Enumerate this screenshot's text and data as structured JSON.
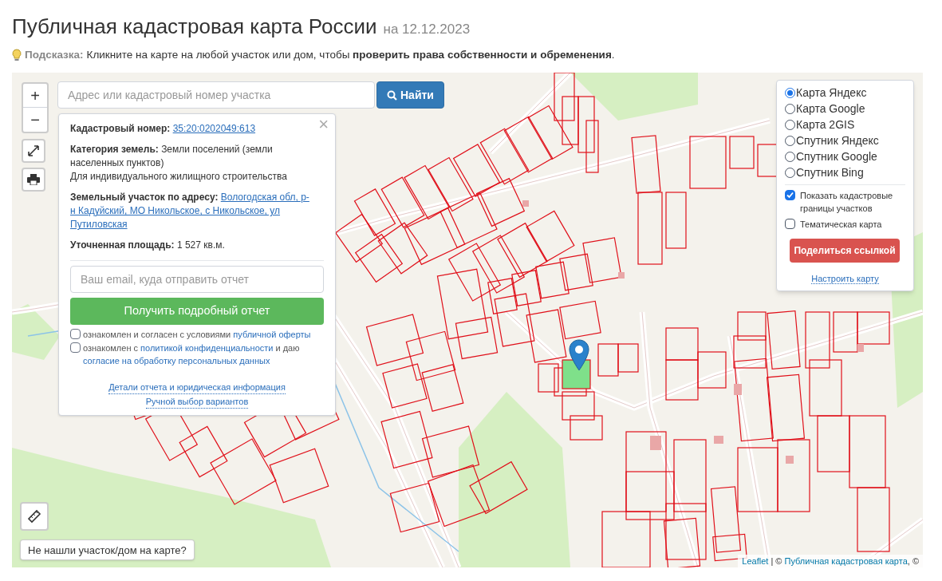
{
  "header": {
    "title": "Публичная кадастровая карта России",
    "date": "на 12.12.2023"
  },
  "hint": {
    "label": "Подсказка:",
    "text": "Кликните на карте на любой участок или дом, чтобы **проверить права собственности и обременения**."
  },
  "search": {
    "placeholder": "Адрес или кадастровый номер участка",
    "button": "Найти"
  },
  "zoom_controls": [
    "+",
    "−"
  ],
  "popup": {
    "close": "×",
    "fields": [
      {
        "label": "Кадастровый номер:",
        "value": "35:20:0202049:613",
        "kind": "link"
      },
      {
        "label": "Категория земель:",
        "value": "Земли поселений (земли населенных пунктов)",
        "note": "Для индивидуального жилищного строительства",
        "kind": "text"
      },
      {
        "label": "Земельный участок по адресу:",
        "value": "Вологодская обл, р-н Кадуйский, МО Никольское, с Никольское, ул Путиловская",
        "kind": "link"
      },
      {
        "label": "Уточненная площадь:",
        "value": "1 527 кв.м.",
        "kind": "text"
      }
    ],
    "email_placeholder": "Ваш email, куда отправить отчет",
    "report_button": "Получить подробный отчет",
    "consents": [
      {
        "checked": false,
        "parts": [
          {
            "text": "ознакомлен и согласен с условиями ",
            "link": false
          },
          {
            "text": "публичной оферты",
            "link": true
          }
        ]
      },
      {
        "checked": false,
        "parts": [
          {
            "text": "ознакомлен с ",
            "link": false
          },
          {
            "text": "политикой конфиденциальности",
            "link": true
          },
          {
            "text": " и даю ",
            "link": false
          },
          {
            "text": "согласие на обработку персональных данных",
            "link": true
          }
        ]
      }
    ],
    "links": [
      "Детали отчета и юридическая информация",
      "Ручной выбор вариантов"
    ]
  },
  "layers": {
    "base_maps": [
      {
        "label": "Карта Яндекс",
        "selected": true
      },
      {
        "label": "Карта Google",
        "selected": false
      },
      {
        "label": "Карта 2GIS",
        "selected": false
      },
      {
        "label": "Спутник Яндекс",
        "selected": false
      },
      {
        "label": "Спутник Google",
        "selected": false
      },
      {
        "label": "Спутник Bing",
        "selected": false
      }
    ],
    "overlays": [
      {
        "label": "Показать кадастровые границы участков",
        "checked": true
      },
      {
        "label": "Тематическая карта",
        "checked": false
      }
    ],
    "share_button": "Поделиться ссылкой",
    "settings_link": "Настроить карту"
  },
  "not_found_button": "Не нашли участок/дом на карте?",
  "attribution": {
    "parts": [
      {
        "text": "Leaflet",
        "link": true
      },
      {
        "text": " | © ",
        "link": false
      },
      {
        "text": "Публичная кадастровая карта",
        "link": true
      },
      {
        "text": ", ©",
        "link": false
      }
    ]
  }
}
